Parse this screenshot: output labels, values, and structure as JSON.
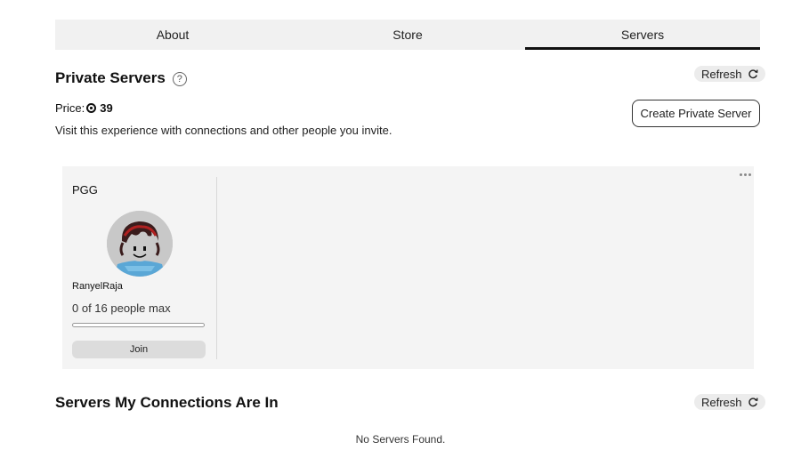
{
  "tabs": [
    {
      "label": "About",
      "active": false
    },
    {
      "label": "Store",
      "active": false
    },
    {
      "label": "Servers",
      "active": true
    }
  ],
  "private_servers": {
    "title": "Private Servers",
    "help_icon": "?",
    "refresh_label": "Refresh",
    "price_label": "Price:",
    "price_value": "39",
    "description": "Visit this experience with connections and other people you invite.",
    "create_button": "Create Private Server",
    "servers": [
      {
        "name": "PGG",
        "owner": "RanyelRaja",
        "capacity_text": "0 of 16 people max",
        "occupancy": 0,
        "join_label": "Join"
      }
    ]
  },
  "connections_servers": {
    "title": "Servers My Connections Are In",
    "refresh_label": "Refresh",
    "empty_text": "No Servers Found."
  },
  "colors": {
    "tab_bg": "#f1f1f1",
    "panel_bg": "#f4f4f4",
    "active_underline": "#111111",
    "join_bg": "#dcdcdc"
  },
  "icons": {
    "help": "question-circle-icon",
    "refresh": "refresh-icon",
    "currency": "robux-icon",
    "menu": "more-dots-icon"
  }
}
